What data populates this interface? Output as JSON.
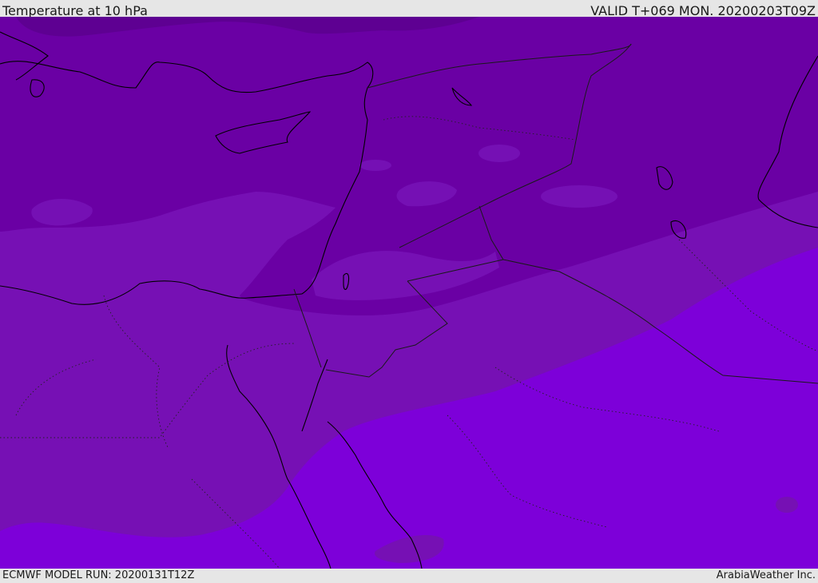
{
  "header": {
    "title": "Temperature at 10 hPa",
    "valid": "VALID T+069 MON. 20200203T09Z"
  },
  "footer": {
    "model_run": "ECMWF MODEL RUN: 20200131T12Z",
    "credit": "ArabiaWeather Inc."
  },
  "colors": {
    "band_coldest": "#5e0092",
    "band_cold": "#6b00a6",
    "band_mid": "#7510b2",
    "band_warm": "#7a0fc0",
    "band_warmest": "#7d00d9",
    "coast_line": "#000000",
    "border_line": "#1a1a1a"
  }
}
